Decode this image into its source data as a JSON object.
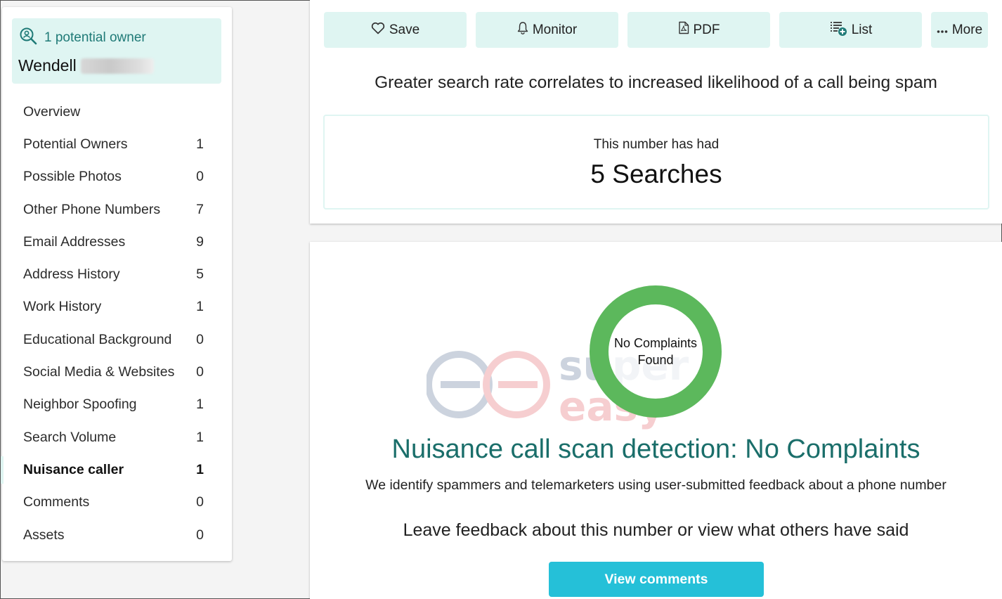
{
  "owner": {
    "count_label": "1 potential owner",
    "name": "Wendell"
  },
  "nav": [
    {
      "label": "Overview",
      "count": ""
    },
    {
      "label": "Potential Owners",
      "count": "1"
    },
    {
      "label": "Possible Photos",
      "count": "0"
    },
    {
      "label": "Other Phone Numbers",
      "count": "7"
    },
    {
      "label": "Email Addresses",
      "count": "9"
    },
    {
      "label": "Address History",
      "count": "5"
    },
    {
      "label": "Work History",
      "count": "1"
    },
    {
      "label": "Educational Background",
      "count": "0"
    },
    {
      "label": "Social Media & Websites",
      "count": "0"
    },
    {
      "label": "Neighbor Spoofing",
      "count": "1"
    },
    {
      "label": "Search Volume",
      "count": "1"
    },
    {
      "label": "Nuisance caller",
      "count": "1",
      "active": true
    },
    {
      "label": "Comments",
      "count": "0"
    },
    {
      "label": "Assets",
      "count": "0"
    }
  ],
  "toolbar": {
    "save": "Save",
    "monitor": "Monitor",
    "pdf": "PDF",
    "list": "List",
    "more": "More"
  },
  "search_section": {
    "headline": "Greater search rate correlates to increased likelihood of a call being spam",
    "subtext": "This number has had",
    "count_text": "5 Searches"
  },
  "nuisance": {
    "ring_text_line1": "No Complaints",
    "ring_text_line2": "Found",
    "title": "Nuisance call scan detection: No Complaints",
    "description": "We identify spammers and telemarketers using user-submitted feedback about a phone number",
    "feedback_prompt": "Leave feedback about this number or view what others have said",
    "button_label": "View comments"
  },
  "watermark": {
    "line1": "super",
    "line2": "easy"
  },
  "colors": {
    "accent_light": "#dff5f2",
    "teal_text": "#1a6e6a",
    "ring_green": "#5cb85c",
    "button_cyan": "#25c0d8"
  }
}
